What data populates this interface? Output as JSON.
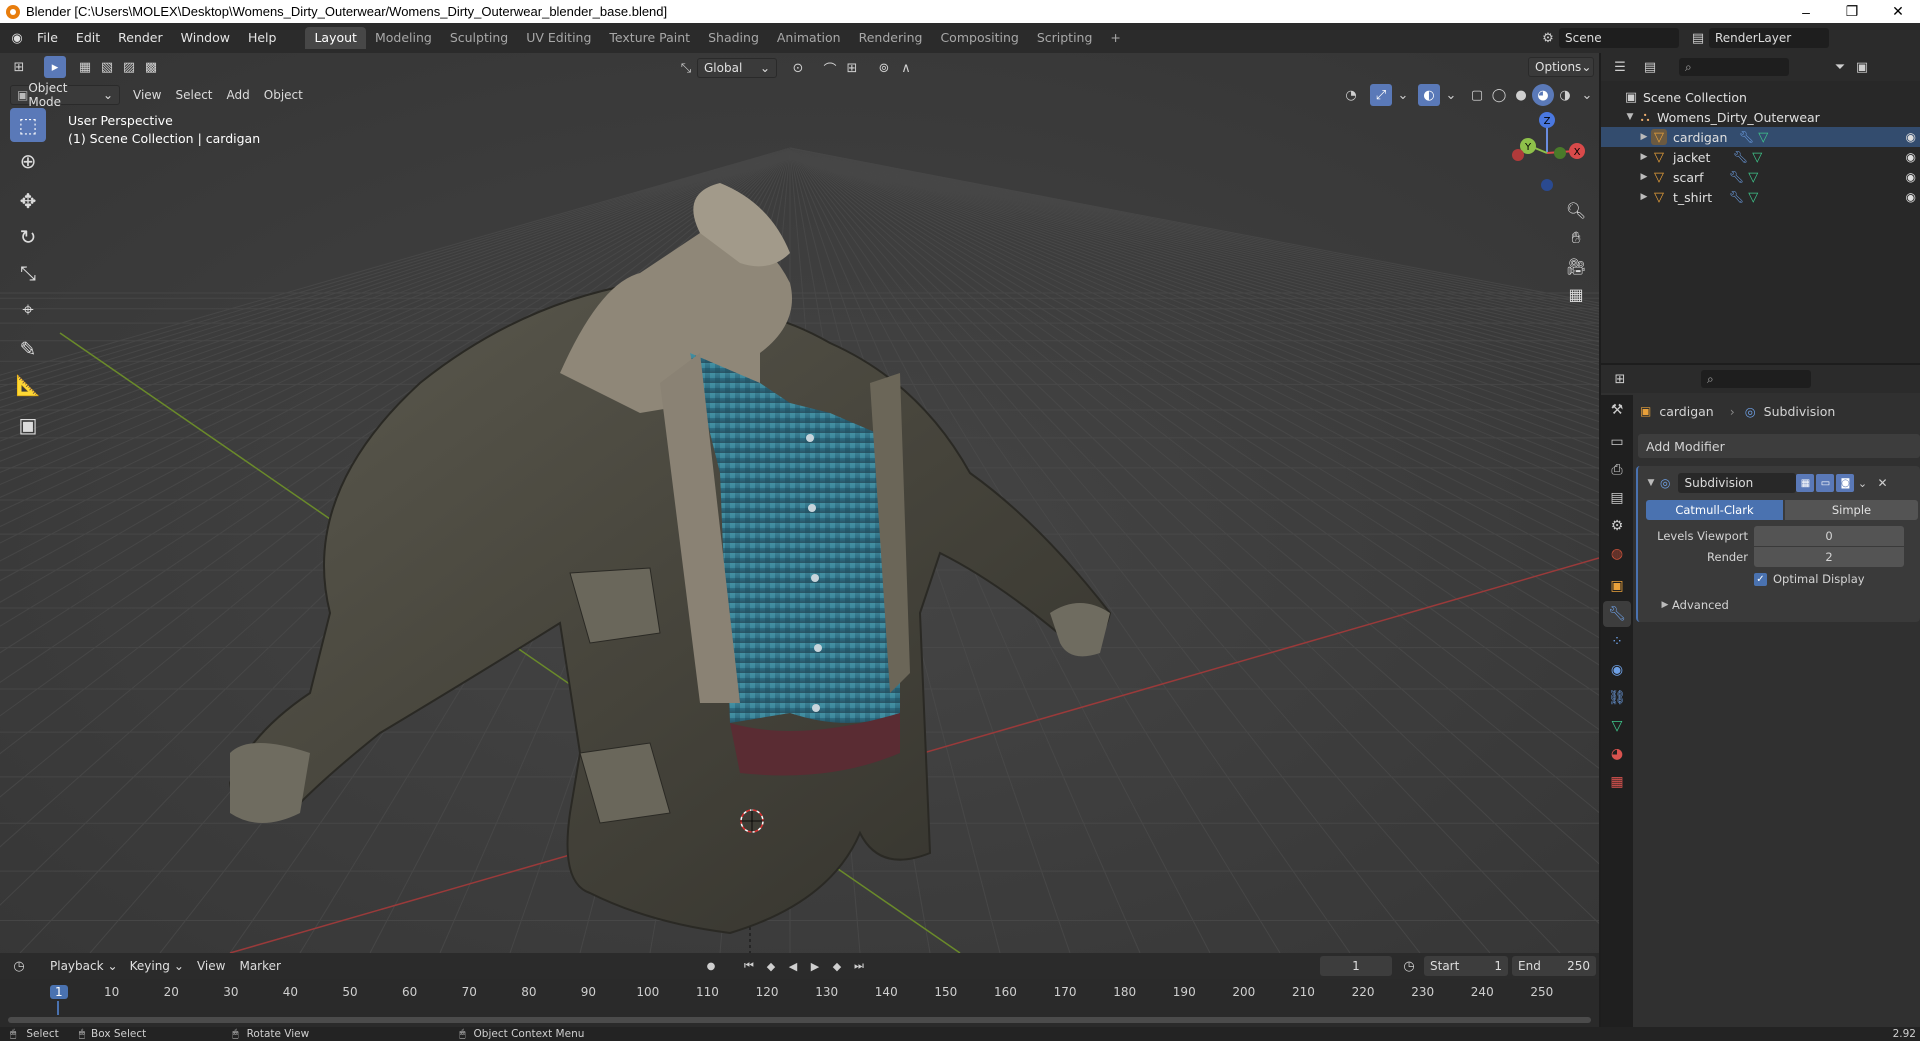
{
  "window": {
    "title": "Blender [C:\\Users\\MOLEX\\Desktop\\Womens_Dirty_Outerwear/Womens_Dirty_Outerwear_blender_base.blend]",
    "controls": [
      "–",
      "❐",
      "✕"
    ]
  },
  "menu": [
    "File",
    "Edit",
    "Render",
    "Window",
    "Help"
  ],
  "workspaces": [
    "Layout",
    "Modeling",
    "Sculpting",
    "UV Editing",
    "Texture Paint",
    "Shading",
    "Animation",
    "Rendering",
    "Compositing",
    "Scripting"
  ],
  "active_workspace": "Layout",
  "add_workspace": "+",
  "scene_field": "Scene",
  "renderlayer_field": "RenderLayer",
  "viewport": {
    "mode": "Object Mode",
    "menus": [
      "View",
      "Select",
      "Add",
      "Object"
    ],
    "orientation": "Global",
    "options": "Options",
    "overlay_line1": "User Perspective",
    "overlay_line2": "(1) Scene Collection | cardigan",
    "gizmo_axes": [
      "Z",
      "Y",
      "X"
    ],
    "tools": [
      "select-box",
      "cursor",
      "move",
      "rotate",
      "scale",
      "transform",
      "annotate",
      "measure",
      "add-cube"
    ],
    "colors": {
      "bg": "#3d3d3d",
      "grid": "#4a4a4a",
      "x_axis": "#9a3a3a",
      "y_axis": "#6a8a2a"
    }
  },
  "outliner": {
    "root": "Scene Collection",
    "collection": "Womens_Dirty_Outerwear",
    "items": [
      "cardigan",
      "jacket",
      "scarf",
      "t_shirt"
    ]
  },
  "properties": {
    "breadcrumb_object": "cardigan",
    "breadcrumb_modifier": "Subdivision",
    "add_modifier": "Add Modifier",
    "modifier_name": "Subdivision",
    "type_options": [
      "Catmull-Clark",
      "Simple"
    ],
    "selected_type": "Catmull-Clark",
    "levels_viewport_label": "Levels Viewport",
    "levels_viewport_value": "0",
    "render_label": "Render",
    "render_value": "2",
    "optimal_display_label": "Optimal Display",
    "optimal_display_checked": true,
    "advanced_label": "Advanced"
  },
  "timeline": {
    "menus": [
      "Playback",
      "Keying",
      "View",
      "Marker"
    ],
    "current_frame": "1",
    "start_label": "Start",
    "start_value": "1",
    "end_label": "End",
    "end_value": "250",
    "ticks": [
      "1",
      "10",
      "20",
      "30",
      "40",
      "50",
      "60",
      "70",
      "80",
      "90",
      "100",
      "110",
      "120",
      "130",
      "140",
      "150",
      "160",
      "170",
      "180",
      "190",
      "200",
      "210",
      "220",
      "230",
      "240",
      "250"
    ]
  },
  "statusbar": {
    "select": "Select",
    "box_select": "Box Select",
    "rotate_view": "Rotate View",
    "context_menu": "Object Context Menu",
    "version": "2.92"
  }
}
